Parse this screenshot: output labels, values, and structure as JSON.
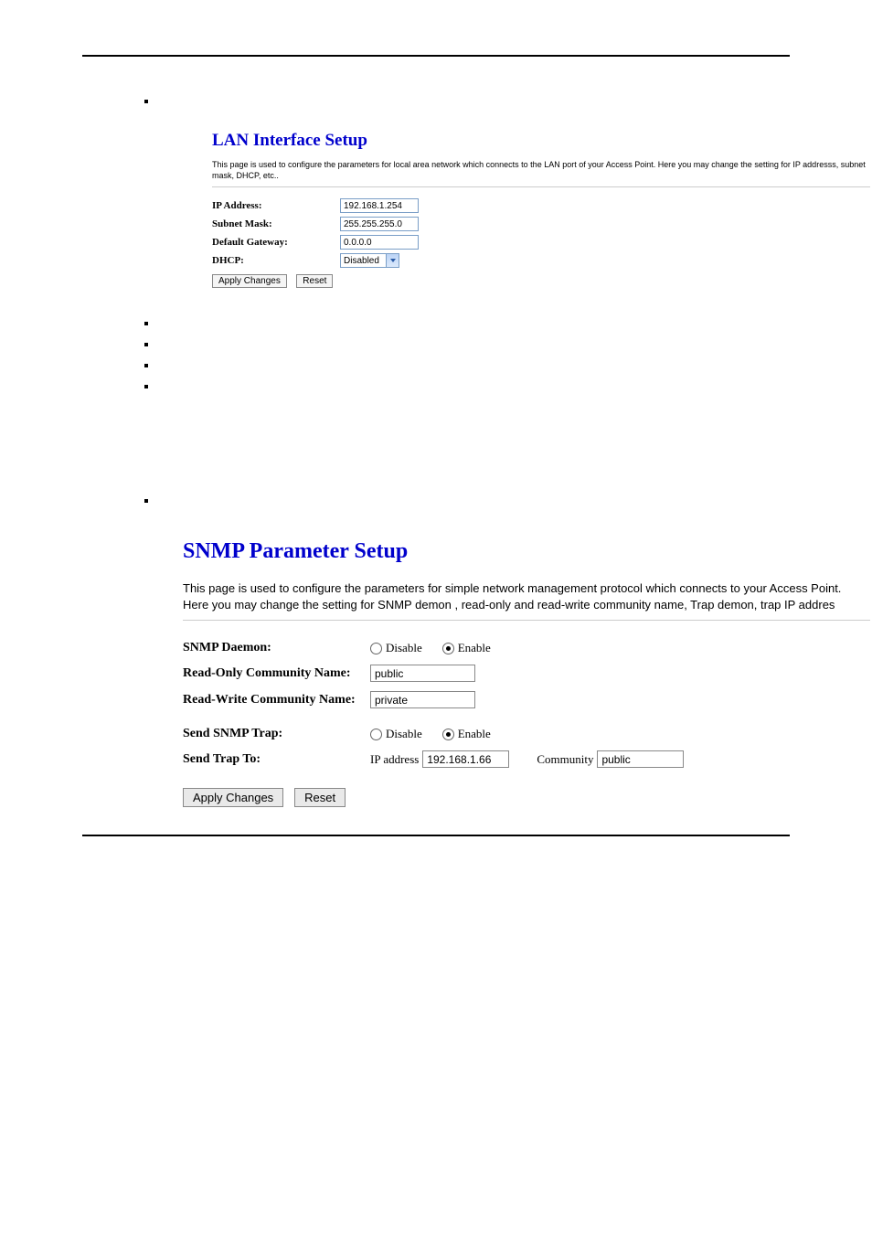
{
  "bullets": {
    "b0": ""
  },
  "lan": {
    "title": "LAN Interface Setup",
    "desc": "This page is used to configure the parameters for local area network which connects to the LAN port of your Access Point. Here you may change the setting for IP addresss, subnet mask, DHCP, etc..",
    "labels": {
      "ip": "IP Address:",
      "mask": "Subnet Mask:",
      "gw": "Default Gateway:",
      "dhcp": "DHCP:"
    },
    "values": {
      "ip": "192.168.1.254",
      "mask": "255.255.255.0",
      "gw": "0.0.0.0",
      "dhcp": "Disabled"
    },
    "buttons": {
      "apply": "Apply Changes",
      "reset": "Reset"
    }
  },
  "mid_bullets": {
    "b1": "",
    "b2": "",
    "b3": "",
    "b4": ""
  },
  "b5": "",
  "snmp": {
    "title": "SNMP Parameter Setup",
    "desc": "This page is used to configure the parameters for simple network management protocol which connects to your Access Point. Here you may change the setting for SNMP demon , read-only and read-write community name, Trap demon, trap IP addres",
    "labels": {
      "daemon": "SNMP Daemon:",
      "ro": "Read-Only Community Name:",
      "rw": "Read-Write Community Name:",
      "trap": "Send SNMP Trap:",
      "trapto": "Send Trap To:"
    },
    "radio": {
      "disable": "Disable",
      "enable": "Enable"
    },
    "values": {
      "ro": "public",
      "rw": "private",
      "trap_ip": "192.168.1.66",
      "trap_comm": "public"
    },
    "sublabels": {
      "ip": "IP address",
      "comm": "Community"
    },
    "buttons": {
      "apply": "Apply Changes",
      "reset": "Reset"
    }
  }
}
